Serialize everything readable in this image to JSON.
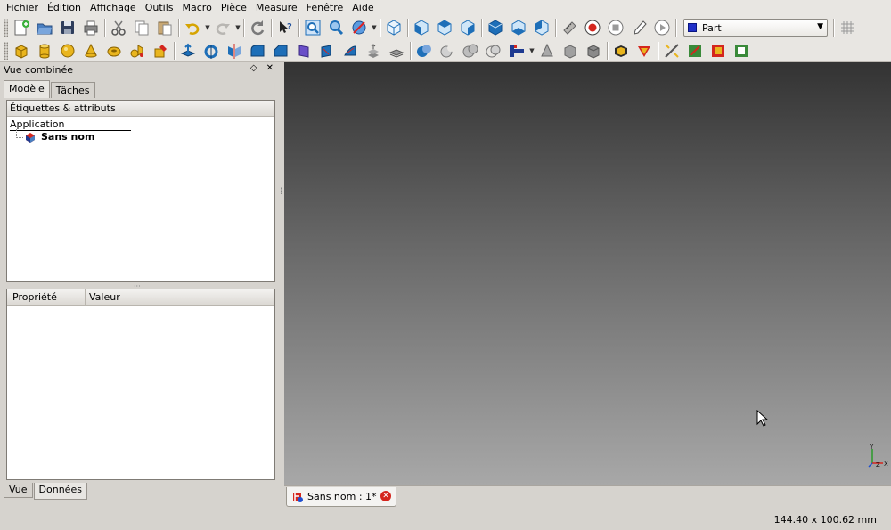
{
  "menubar": {
    "items": [
      "Fichier",
      "Édition",
      "Affichage",
      "Outils",
      "Macro",
      "Pièce",
      "Measure",
      "Fenêtre",
      "Aide"
    ]
  },
  "toolbar": {
    "workbench_selector": "Part"
  },
  "combo_view": {
    "title": "Vue combinée",
    "tabs": [
      "Modèle",
      "Tâches"
    ],
    "tree_header": "Étiquettes & attributs",
    "tree_root": "Application",
    "document_name": "Sans nom",
    "property_columns": [
      "Propriété",
      "Valeur"
    ],
    "bottom_tabs": [
      "Vue",
      "Données"
    ]
  },
  "document_tab": {
    "label": "Sans nom : 1*"
  },
  "axis_labels": {
    "x": "X",
    "y": "Y",
    "z": "Z"
  },
  "status_bar": {
    "dimensions": "144.40 x 100.62 mm"
  },
  "colors": {
    "background": "#d6d3ce",
    "view_top": "#333333",
    "view_bottom": "#a8a8a8",
    "accent_blue": "#1e6fb8",
    "close_red": "#d4261e"
  }
}
